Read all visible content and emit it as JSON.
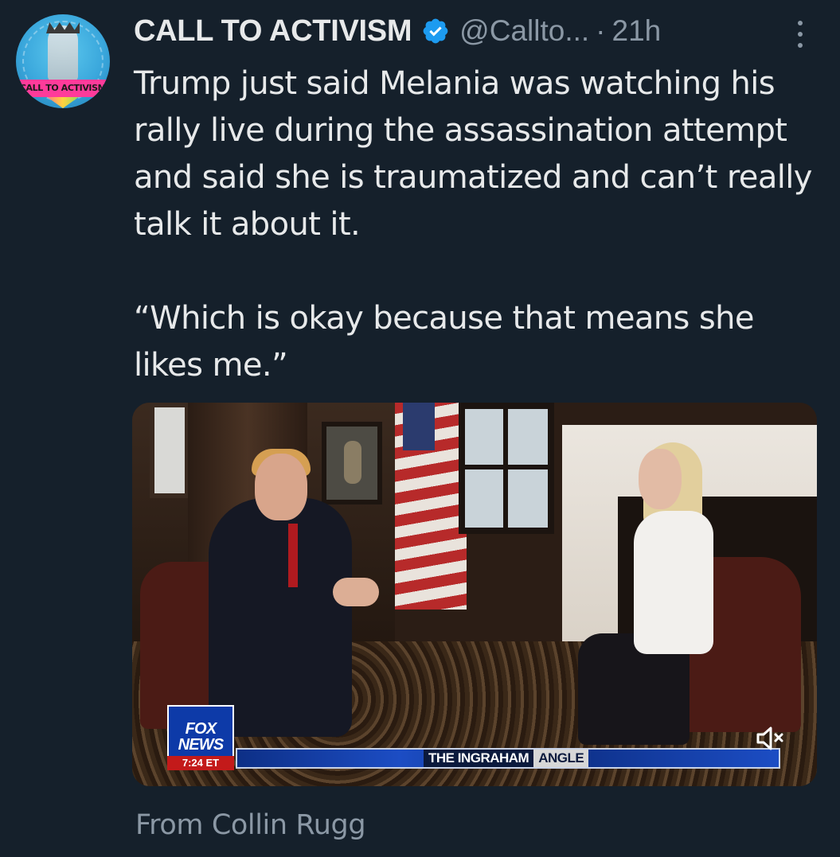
{
  "author": {
    "display_name": "CALL TO ACTIVISM",
    "handle": "@Callto...",
    "separator": "·",
    "timestamp": "21h",
    "avatar_text": "CALL TO ACTIVISM",
    "verified_icon": "verified-badge-icon"
  },
  "tweet": {
    "paragraphs": [
      "Trump just said Melania was watching his rally live during the assassination attempt and said she is traumatized and can’t really talk it about it.",
      "“Which is okay because that means she likes me.”"
    ]
  },
  "media": {
    "type": "video",
    "network_logo_line1": "FOX",
    "network_logo_line2": "NEWS",
    "clock": "7:24 ET",
    "show_title_part1": "THE INGRAHAM",
    "show_title_part2": "ANGLE",
    "mute_icon": "muted-speaker-icon"
  },
  "attribution": "From Collin Rugg",
  "colors": {
    "background": "#15202b",
    "primary_text": "#e7e9ea",
    "secondary_text": "#8b98a5",
    "verified_blue": "#1d9bf0"
  }
}
